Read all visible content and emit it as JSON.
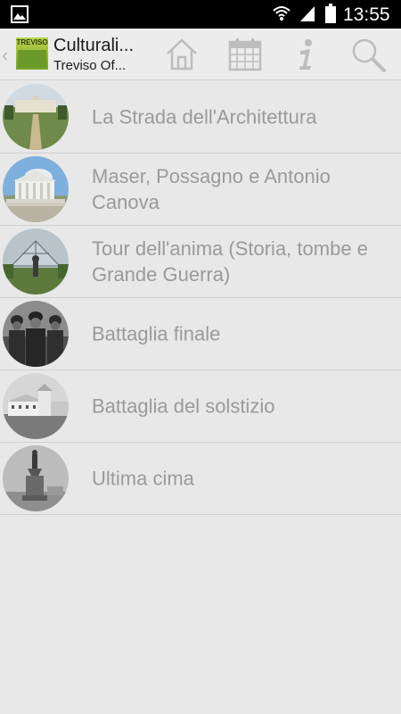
{
  "status_bar": {
    "time": "13:55"
  },
  "action_bar": {
    "logo_text": "TREVISO",
    "title": "Culturali...",
    "subtitle": "Treviso Of..."
  },
  "icons": {
    "status": [
      "picture-icon",
      "wifi-icon",
      "signal-icon",
      "battery-icon"
    ],
    "actions": [
      "home-icon",
      "calendar-icon",
      "info-icon",
      "search-icon"
    ]
  },
  "colors": {
    "background": "#e8e8e8",
    "label": "#9a9a9a",
    "status_bar": "#000000",
    "icon": "#bdbdbd"
  },
  "items": [
    {
      "label": "La Strada dell'Architettura",
      "thumb": "villa-photo"
    },
    {
      "label": "Maser, Possagno e Antonio Canova",
      "thumb": "temple-photo"
    },
    {
      "label": "Tour dell'anima (Storia, tombe e Grande Guerra)",
      "thumb": "memorial-photo"
    },
    {
      "label": "Battaglia finale",
      "thumb": "soldiers-photo"
    },
    {
      "label": "Battaglia del solstizio",
      "thumb": "building-photo"
    },
    {
      "label": "Ultima cima",
      "thumb": "statue-photo"
    }
  ]
}
